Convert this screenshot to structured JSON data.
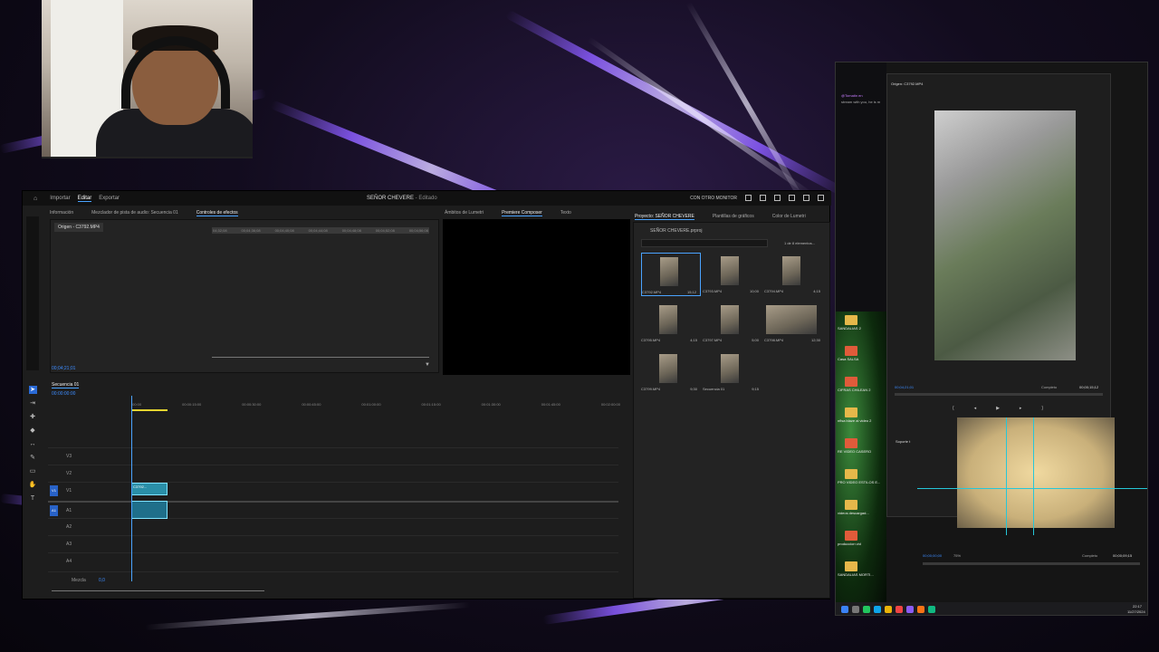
{
  "premiere": {
    "nav": {
      "home": "⌂",
      "import": "Importar",
      "edit": "Editar",
      "export": "Exportar"
    },
    "title": "SEÑOR CHEVERE",
    "title_status": " - Editado",
    "monitor_label": "CON OTRO MONITOR",
    "source_tabs": [
      "Información",
      "Mezclador de pista de audio: Secuencia 01",
      "Controles de efectos"
    ],
    "source_clip": "Origen - C3792.MP4",
    "ruler": [
      "04;32;08",
      "00;04;36;08",
      "00;04;40;08",
      "00;04;44;08",
      "00;04;48;08",
      "00;04;52;08",
      "00;04;56;08"
    ],
    "source_timecode": "00;04;21;01",
    "program_tabs": [
      "Ámbitos de Lumetri",
      "Premiere Composer",
      "Texto"
    ],
    "project_tabs": [
      "Proyecto: SEÑOR CHEVERE",
      "Plantillas de gráficos",
      "Color de Lumetri"
    ],
    "project_file": "SEÑOR CHEVERE.prproj",
    "items_count": "1 de 8 elementos...",
    "thumbs": [
      {
        "name": "C3792.MP4",
        "dur": "15;12"
      },
      {
        "name": "C3793.MP4",
        "dur": "10;00"
      },
      {
        "name": "C3794.MP4",
        "dur": "4;15"
      },
      {
        "name": "C3795.MP4",
        "dur": "4;15"
      },
      {
        "name": "C3797.MP4",
        "dur": "5;00"
      },
      {
        "name": "C3798.MP4",
        "dur": "12;30"
      },
      {
        "name": "C3799.MP4",
        "dur": "9;30"
      },
      {
        "name": "Secuencia 01",
        "dur": "9;15"
      }
    ],
    "sequence_tab": "Secuencia 01",
    "seq_timecode": "00:00:00:00",
    "tl_ruler": [
      ":00:00",
      "00:00:15:00",
      "00:00:30:00",
      "00:00:45:00",
      "00:01:00:00",
      "00:01:15:00",
      "00:01:30:00",
      "00:01:45:00",
      "00:02:00:00"
    ],
    "tracks": [
      "V3",
      "V2",
      "V1",
      "A1",
      "A2",
      "A3",
      "A4"
    ],
    "clip_label": "C3792...",
    "mix_label": "Mezcla",
    "mix_value": "0,0"
  },
  "right_window": {
    "origin_label": "Origen: C3792.MP4",
    "chat_line1": "@Tomatin en",
    "chat_line2": "stream with you, he is m",
    "fit1": "Completo",
    "tc1": "00;04;21;01",
    "end1": "00;00;15;12",
    "fit2": "Completo",
    "zoom2": "75%",
    "tc2": "00;00;00;00",
    "end2": "00;00;09;15",
    "soporte": "Soporte t",
    "desk_items": [
      "SANDALIAS 2",
      "Casa SALSA",
      "CIFRAS CHILEAN 2",
      "nflsa blaze al video 2",
      "RE VIDEO CASERO",
      "PRO VIDEO ESTILOS E...",
      "videos descargad...",
      "produccion vid",
      "SANDALIAS MORTI..."
    ],
    "clock": "22:17",
    "date": "11/27/2024"
  },
  "colors": {
    "accent": "#4aa3ff",
    "track_badge": "#2862c7",
    "clip": "#2a8fa8"
  }
}
